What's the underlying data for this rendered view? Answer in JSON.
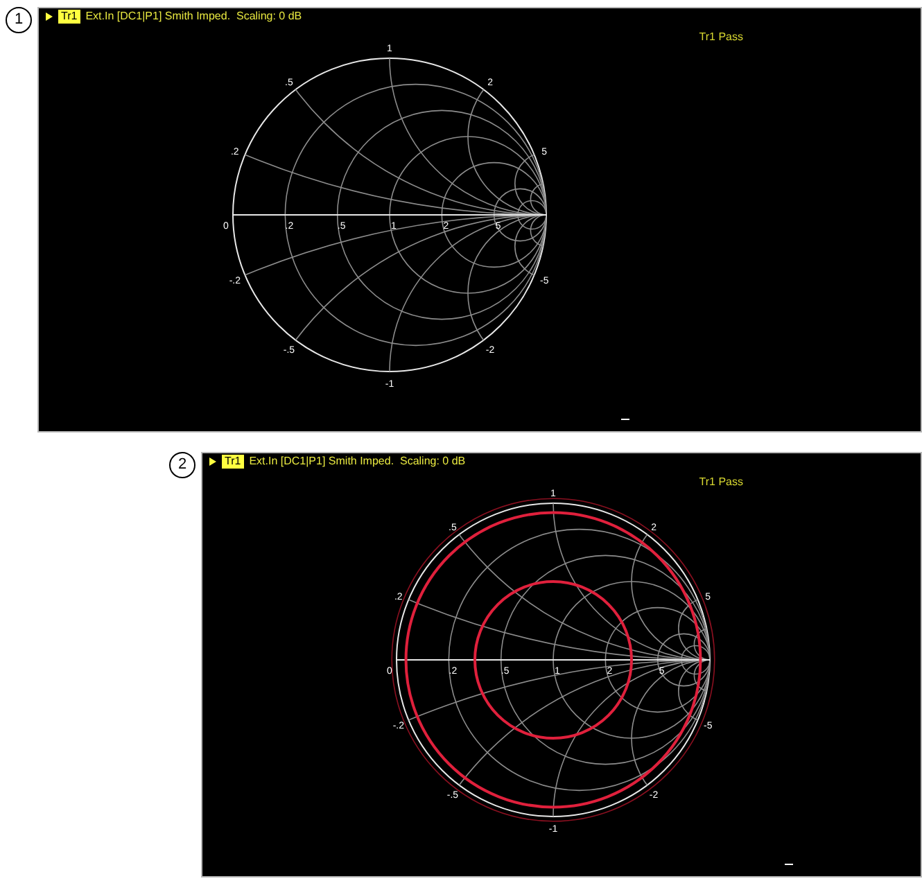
{
  "panels": [
    {
      "number": "1",
      "kind": "grid",
      "trace_label": "Tr1",
      "header": "Ext.In [DC1|P1] Smith Imped.  Scaling: 0 dB",
      "status": "Tr1 Pass",
      "resistance_labels": [
        "0",
        ".2",
        ".5",
        "1",
        "2",
        "5"
      ],
      "reactance_labels": [
        "1",
        ".5",
        ".2",
        "2",
        "5",
        "-.2",
        "-.5",
        "-1",
        "-2",
        "-5"
      ]
    },
    {
      "number": "2",
      "kind": "traces",
      "trace_label": "Tr1",
      "header": "Ext.In [DC1|P1] Smith Imped.  Scaling: 0 dB",
      "status": "Tr1 Pass",
      "resistance_labels": [
        "0",
        ".2",
        ".5",
        "1",
        "2",
        "5"
      ],
      "reactance_labels": [
        "1",
        ".5",
        ".2",
        "2",
        "5",
        "-.2",
        "-.5",
        "-1",
        "-2",
        "-5"
      ]
    }
  ]
}
